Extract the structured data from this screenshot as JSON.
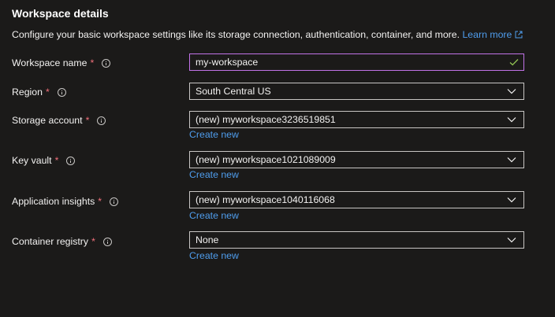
{
  "header": {
    "title": "Workspace details",
    "description": "Configure your basic workspace settings like its storage connection, authentication, container, and more.",
    "learn_more": "Learn more"
  },
  "fields": {
    "workspace_name": {
      "label": "Workspace name",
      "required": "*",
      "value": "my-workspace",
      "valid": true
    },
    "region": {
      "label": "Region",
      "required": "*",
      "value": "South Central US"
    },
    "storage_account": {
      "label": "Storage account",
      "required": "*",
      "value": "(new) myworkspace3236519851",
      "create_new": "Create new"
    },
    "key_vault": {
      "label": "Key vault",
      "required": "*",
      "value": "(new) myworkspace1021089009",
      "create_new": "Create new"
    },
    "application_insights": {
      "label": "Application insights",
      "required": "*",
      "value": "(new) myworkspace1040116068",
      "create_new": "Create new"
    },
    "container_registry": {
      "label": "Container registry",
      "required": "*",
      "value": "None",
      "create_new": "Create new"
    }
  },
  "icons": {
    "info": "info-icon",
    "chevron": "chevron-down-icon",
    "check": "check-icon",
    "external_link": "external-link-icon"
  },
  "colors": {
    "background": "#1b1a19",
    "text": "#f3f2f1",
    "link": "#4f9ded",
    "required": "#f1707b",
    "focus_border": "#c273e8",
    "valid_check": "#92c353",
    "border": "#c8c6c4"
  }
}
